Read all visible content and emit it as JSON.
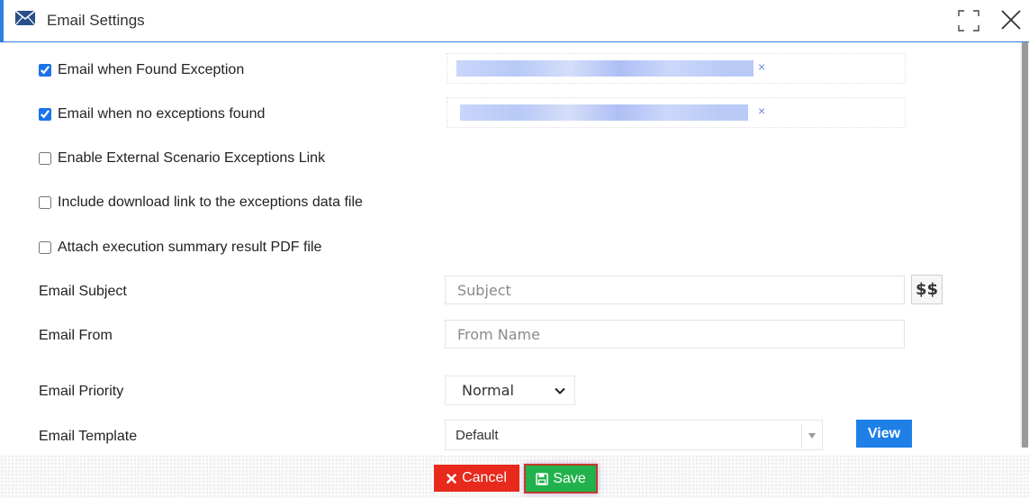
{
  "window": {
    "title": "Email Settings",
    "icon": "envelope-icon",
    "accent_color": "#2f7fe0"
  },
  "checkboxes": [
    {
      "label": "Email when Found Exception",
      "checked": true
    },
    {
      "label": "Email when no exceptions found",
      "checked": true
    },
    {
      "label": "Enable External Scenario Exceptions Link",
      "checked": false
    },
    {
      "label": "Include download link to the exceptions data file",
      "checked": false
    },
    {
      "label": "Attach execution summary result PDF file",
      "checked": false
    }
  ],
  "recipients": {
    "remove_glyph": "×"
  },
  "fields": {
    "subject_label": "Email Subject",
    "subject_placeholder": "Subject",
    "subject_value": "",
    "variables_button_label": "$$",
    "from_label": "Email From",
    "from_placeholder": "From Name",
    "from_value": "",
    "priority_label": "Email Priority",
    "priority_value": "Normal",
    "template_label": "Email Template",
    "template_value": "Default",
    "view_button_label": "View"
  },
  "footer": {
    "cancel_label": "Cancel",
    "save_label": "Save",
    "cancel_color": "#e8291c",
    "save_color": "#22b14c"
  }
}
